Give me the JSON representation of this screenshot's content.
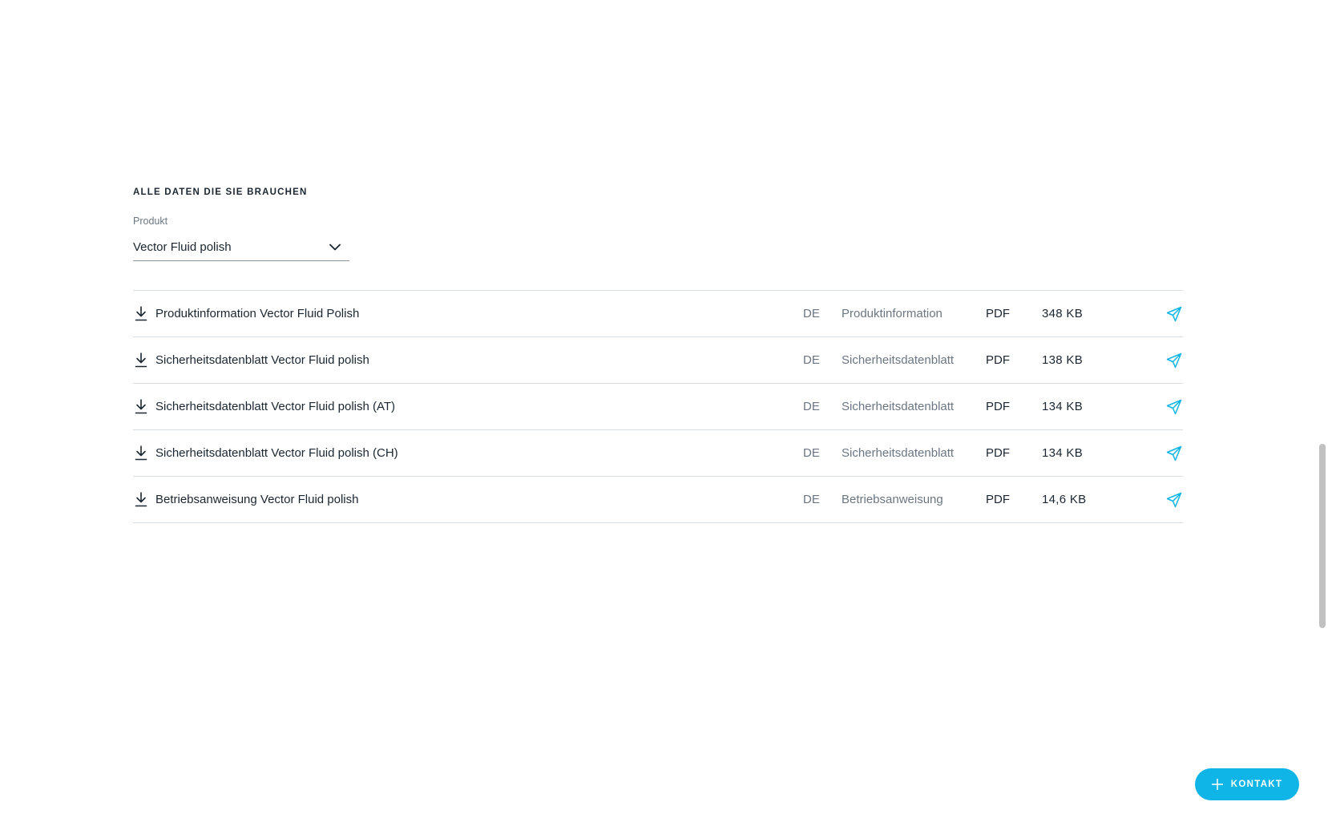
{
  "section": {
    "heading": "ALLE DATEN DIE SIE BRAUCHEN",
    "product_select": {
      "label": "Produkt",
      "value": "Vector Fluid polish"
    }
  },
  "documents": [
    {
      "title": "Produktinformation Vector Fluid Polish",
      "lang": "DE",
      "type": "Produktinformation",
      "format": "PDF",
      "size": "348 KB"
    },
    {
      "title": "Sicherheitsdatenblatt Vector Fluid polish",
      "lang": "DE",
      "type": "Sicherheitsdatenblatt",
      "format": "PDF",
      "size": "138 KB"
    },
    {
      "title": "Sicherheitsdatenblatt Vector Fluid polish (AT)",
      "lang": "DE",
      "type": "Sicherheitsdatenblatt",
      "format": "PDF",
      "size": "134 KB"
    },
    {
      "title": "Sicherheitsdatenblatt Vector Fluid polish (CH)",
      "lang": "DE",
      "type": "Sicherheitsdatenblatt",
      "format": "PDF",
      "size": "134 KB"
    },
    {
      "title": "Betriebsanweisung Vector Fluid polish",
      "lang": "DE",
      "type": "Betriebsanweisung",
      "format": "PDF",
      "size": "14,6 KB"
    }
  ],
  "contact_button": {
    "label": "KONTAKT",
    "icon": "plus-icon"
  },
  "colors": {
    "accent": "#0fb5e6",
    "text": "#1b2631",
    "muted": "#6b7682",
    "divider": "#d8dde2"
  }
}
